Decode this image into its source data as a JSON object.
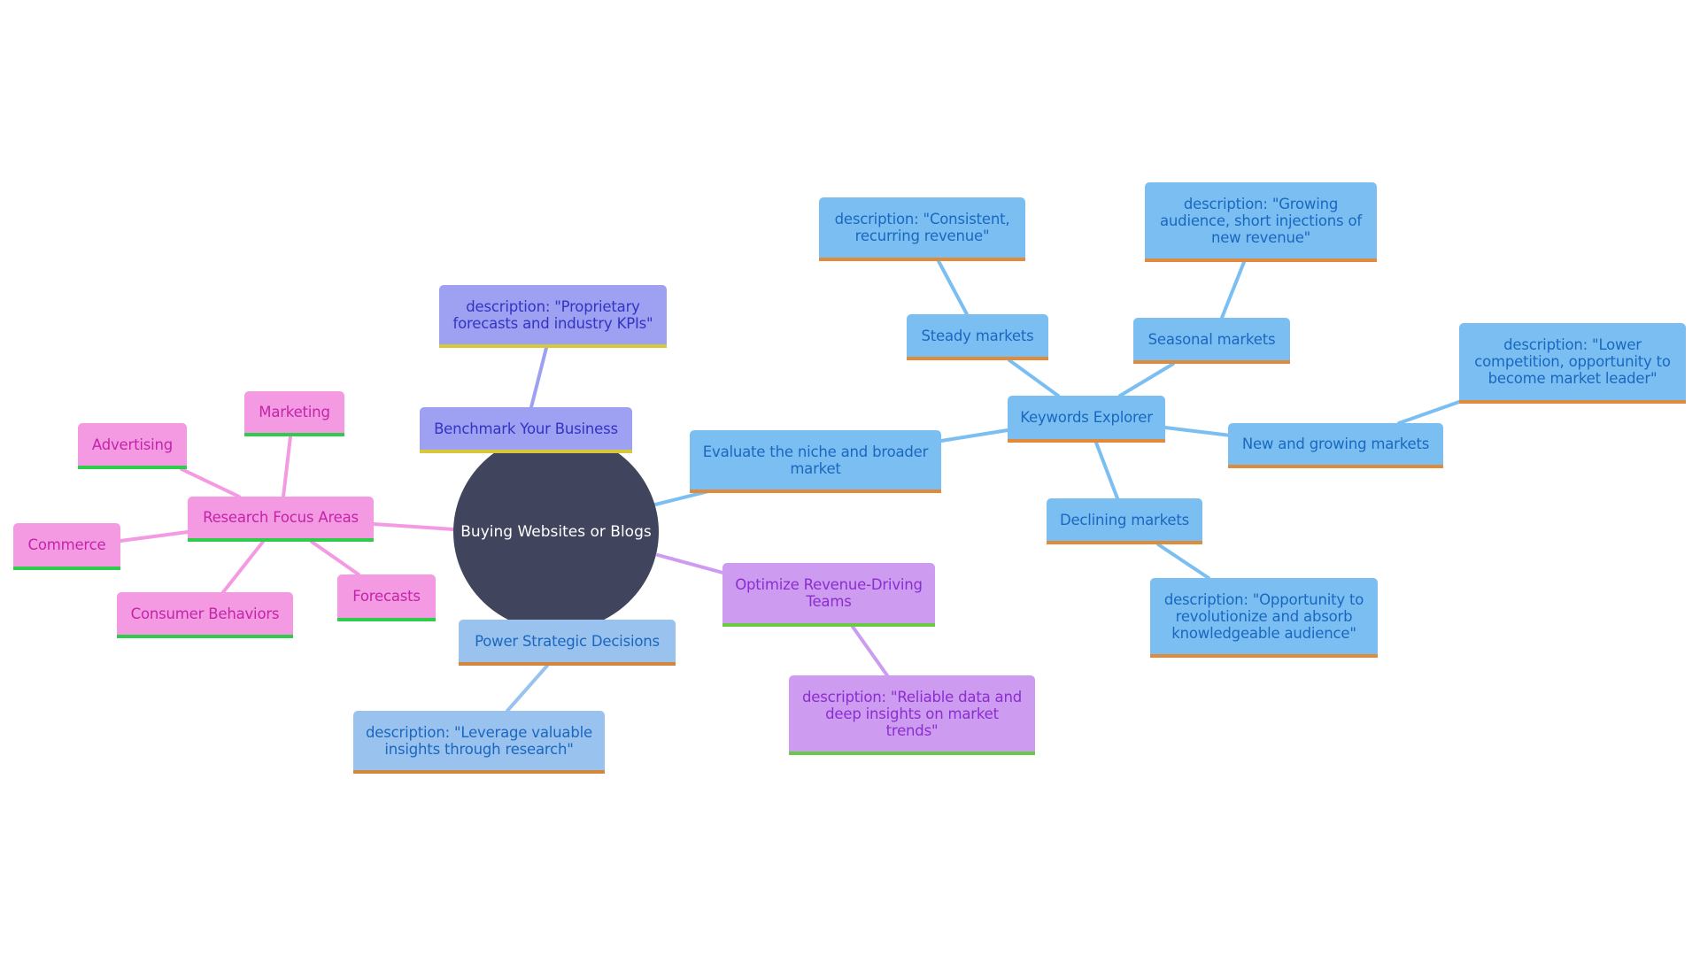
{
  "root": {
    "label": "Buying Websites or Blogs"
  },
  "branches": {
    "benchmark": {
      "label": "Benchmark Your Business",
      "desc": "description: \"Proprietary forecasts and industry KPIs\""
    },
    "evaluate": {
      "label": "Evaluate the niche and broader market",
      "keywords": {
        "label": "Keywords Explorer",
        "steady": {
          "label": "Steady markets",
          "desc": "description: \"Consistent, recurring revenue\""
        },
        "seasonal": {
          "label": "Seasonal markets",
          "desc": "description: \"Growing audience, short injections of new revenue\""
        },
        "new": {
          "label": "New and growing markets",
          "desc": "description: \"Lower competition, opportunity to become market leader\""
        },
        "declining": {
          "label": "Declining markets",
          "desc": "description: \"Opportunity to revolutionize and absorb knowledgeable audience\""
        }
      }
    },
    "optimize": {
      "label": "Optimize Revenue-Driving Teams",
      "desc": "description: \"Reliable data and deep insights on market trends\""
    },
    "power": {
      "label": "Power Strategic Decisions",
      "desc": "description: \"Leverage valuable insights through research\""
    },
    "research": {
      "label": "Research Focus Areas",
      "children": [
        "Marketing",
        "Advertising",
        "Commerce",
        "Consumer Behaviors",
        "Forecasts"
      ]
    }
  },
  "colors": {
    "root": "#40445c",
    "blue": "#7bbff2",
    "light_blue": "#9ac2ee",
    "indigo": "#9ea0f1",
    "violet": "#cd9bf0",
    "pink": "#f39ae3",
    "orange_accent": "#e08a3c",
    "yellow_accent": "#d7c83a",
    "green_accent": "#2ecc4a"
  }
}
